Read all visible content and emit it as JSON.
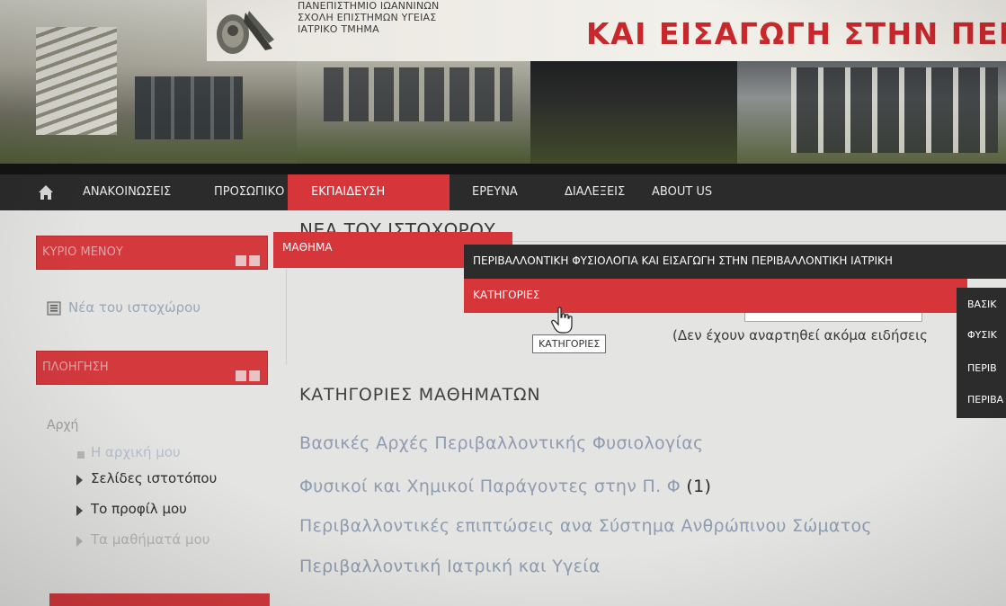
{
  "banner": {
    "school_lines": [
      "ΠΑΝΕΠΙΣΤΗΜΙΟ ΙΩΑΝΝΙΝΩΝ",
      "ΣΧΟΛΗ ΕΠΙΣΤΗΜΩΝ ΥΓΕΙΑΣ",
      "ΙΑΤΡΙΚΟ ΤΜΗΜΑ"
    ],
    "title": "ΚΑΙ ΕΙΣΑΓΩΓΗ ΣΤΗΝ ΠΕΡΙΒ"
  },
  "nav": {
    "home_icon": "home-icon",
    "items": [
      "ΑΝΑΚΟΙΝΩΣΕΙΣ",
      "ΠΡΟΣΩΠΙΚΟ",
      "ΕΚΠΑΙΔΕΥΣΗ",
      "ΕΡΕΥΝΑ",
      "ΔΙΑΛΕΞΕΙΣ",
      "ABOUT US"
    ],
    "active": "ΕΚΠΑΙΔΕΥΣΗ",
    "active_color": "#d6353a"
  },
  "sidebar": {
    "main_menu_title": "ΚΥΡΙΟ ΜΕΝΟΥ",
    "site_news": "Νέα του ιστοχώρου",
    "navigation_title": "ΠΛΟΗΓΗΣΗ",
    "home": "Αρχή",
    "my_home": "Η αρχική μου",
    "site_pages": "Σελίδες ιστοτόπου",
    "my_profile": "Το προφίλ μου",
    "my_courses": "Τα μαθήματά μου"
  },
  "main": {
    "news_title": "ΝΕΑ ΤΟΥ ΙΣΤΟΧΩΡΟΥ",
    "no_news": "(Δεν έχουν αναρτηθεί ακόμα ειδήσεις",
    "categories_heading": "ΚΑΤΗΓΟΡΙΕΣ ΜΑΘΗΜΑΤΩΝ",
    "categories": [
      {
        "name": "Βασικές Αρχές Περιβαλλοντικής Φυσιολογίας",
        "count": ""
      },
      {
        "name": "Φυσικοί και Χημικοί Παράγοντες στην Π. Φ",
        "count": "(1)"
      },
      {
        "name": "Περιβαλλοντικές επιπτώσεις ανα Σύστημα Ανθρώπινου Σώματος",
        "count": ""
      },
      {
        "name": "Περιβαλλοντική Ιατρική και Υγεία",
        "count": ""
      }
    ]
  },
  "dropdown": {
    "level1": "ΜΑΘΗΜΑ",
    "course": "ΠΕΡΙΒΑΛΛΟΝΤΙΚΗ ΦΥΣΙΟΛΟΓΙΑ ΚΑΙ ΕΙΣΑΓΩΓΗ ΣΤΗΝ ΠΕΡΙΒΑΛΛΟΝΤΙΚΗ ΙΑΤΡΙΚΗ",
    "categories": "ΚΑΤΗΓΟΡΙΕΣ",
    "sub_items": [
      "ΒΑΣΙΚ",
      "ΦΥΣΙΚ",
      "ΠΕΡΙΒ",
      "ΠΕΡΙΒΑ"
    ]
  },
  "tooltip": "ΚΑΤΗΓΟΡΙΕΣ",
  "colors": {
    "accent_red": "#d6353a",
    "nav_dark": "#2b2b2b",
    "link_blue_grey": "#8e9cb0",
    "banner_title_red": "#c8282c"
  }
}
